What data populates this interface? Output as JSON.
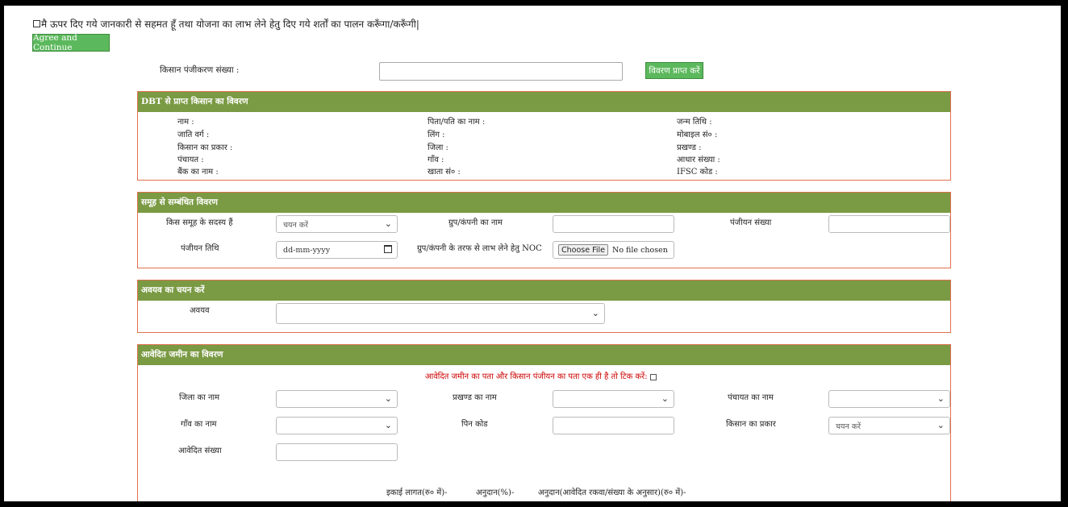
{
  "consent": {
    "text": "मै ऊपर दिए गये जानकारी से सहमत हूँ तथा योजना का लाभ लेने हेतु दिए गये शर्तों का पालन करूँगा/करूँगी|",
    "agree_label": "Agree and Continue"
  },
  "registration": {
    "label": "किसान पंजीकरण संख्या :",
    "value": "",
    "fetch_label": "विवरण प्राप्त करें"
  },
  "dbt": {
    "title": "DBT से प्राप्त किसान का विवरण",
    "col1": [
      "नाम :",
      "जाति वर्ग :",
      "किसान का प्रकार :",
      "पंचायत :",
      "बैंक का नाम :"
    ],
    "col2": [
      "पिता/पति का नाम :",
      "लिंग :",
      "जिला :",
      "गाँव :",
      "खाता सं० :"
    ],
    "col3": [
      "जन्म तिथि :",
      "मोबाइल सं० :",
      "प्रखण्ड :",
      "आधार संख्या :",
      "IFSC कोड :"
    ]
  },
  "group": {
    "title": "समूह से सम्बंधित विवरण",
    "member_label": "किस समूह के सदस्य हैं",
    "member_value": "चयन करें",
    "company_label": "ग्रुप/कंपनी का नाम",
    "reg_no_label": "पंजीयन संख्या",
    "reg_date_label": "पंजीयन तिथि",
    "reg_date_placeholder": "dd-mm-yyyy",
    "noc_label": "ग्रुप/कंपनी के तरफ से लाभ लेने हेतु NOC",
    "choose_file_label": "Choose File",
    "no_file_label": "No file chosen"
  },
  "component": {
    "title": "अवयव का चयन करें",
    "label": "अवयव",
    "value": ""
  },
  "land": {
    "title": "आवेदित जमीन का विवरण",
    "same_address_note": "आवेदित जमीन का पता और किसान पंजीयन का पता एक ही है तो टिक करें:",
    "district_label": "जिला का नाम",
    "block_label": "प्रखण्ड का नाम",
    "panchayat_label": "पंचायत का नाम",
    "village_label": "गाँव का नाम",
    "pin_label": "पिन कोड",
    "farmer_type_label": "किसान का प्रकार",
    "farmer_type_value": "चयन करें",
    "applied_count_label": "आवेदित संख्या",
    "unit_cost_label": "इकाई लागत(रु० में)-",
    "subsidy_pct_label": "अनुदान(%)-",
    "subsidy_amount_label": "अनुदान(आवेदित रकवा/संख्या के अनुसार)(रु० में)-"
  }
}
